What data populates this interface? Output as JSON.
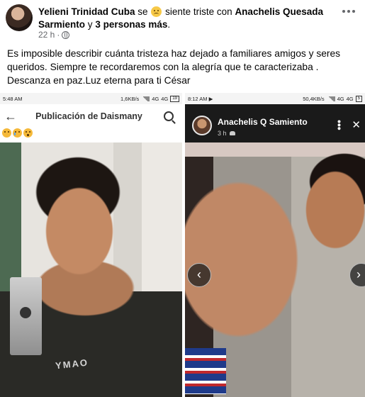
{
  "post": {
    "author": "Yelieni Trinidad Cuba",
    "verb": "se",
    "feeling": "siente triste",
    "with": "con",
    "tagged": "Anachelis Quesada Sarmiento",
    "and": "y",
    "others": "3 personas más",
    "period": ".",
    "time": "22 h",
    "dot": "·",
    "caption": "Es imposible describir cuánta tristeza haz dejado a familiares amigos y seres queridos. Siempre te recordaremos con la alegría que te caracterizaba . Descanza en paz.Luz eterna para ti César"
  },
  "left_screenshot": {
    "time": "5:48 AM",
    "speed": "1,6KB/s",
    "net": "4G",
    "net2": "4G",
    "battery": "19",
    "title": "Publicación de Daismany",
    "back_glyph": "←",
    "shirt_text": "YMAO"
  },
  "right_screenshot": {
    "time": "8:12 AM",
    "play_glyph": "▶",
    "speed": "50,4KB/s",
    "net": "4G",
    "net2": "4G",
    "battery": "5",
    "name": "Anachelis Q Samiento",
    "age": "3 h",
    "prev_glyph": "‹",
    "next_glyph": "›",
    "close_glyph": "✕",
    "more_glyph": "•••"
  },
  "icons": {
    "feeling_emoji": "sad-face-icon",
    "privacy": "globe-icon",
    "more": "more-options-icon",
    "reactions": [
      "sad-face-icon",
      "crying-face-icon",
      "pleading-face-icon"
    ]
  },
  "colors": {
    "text": "#050505",
    "meta": "#65676b",
    "emoji": "#f7c948"
  }
}
